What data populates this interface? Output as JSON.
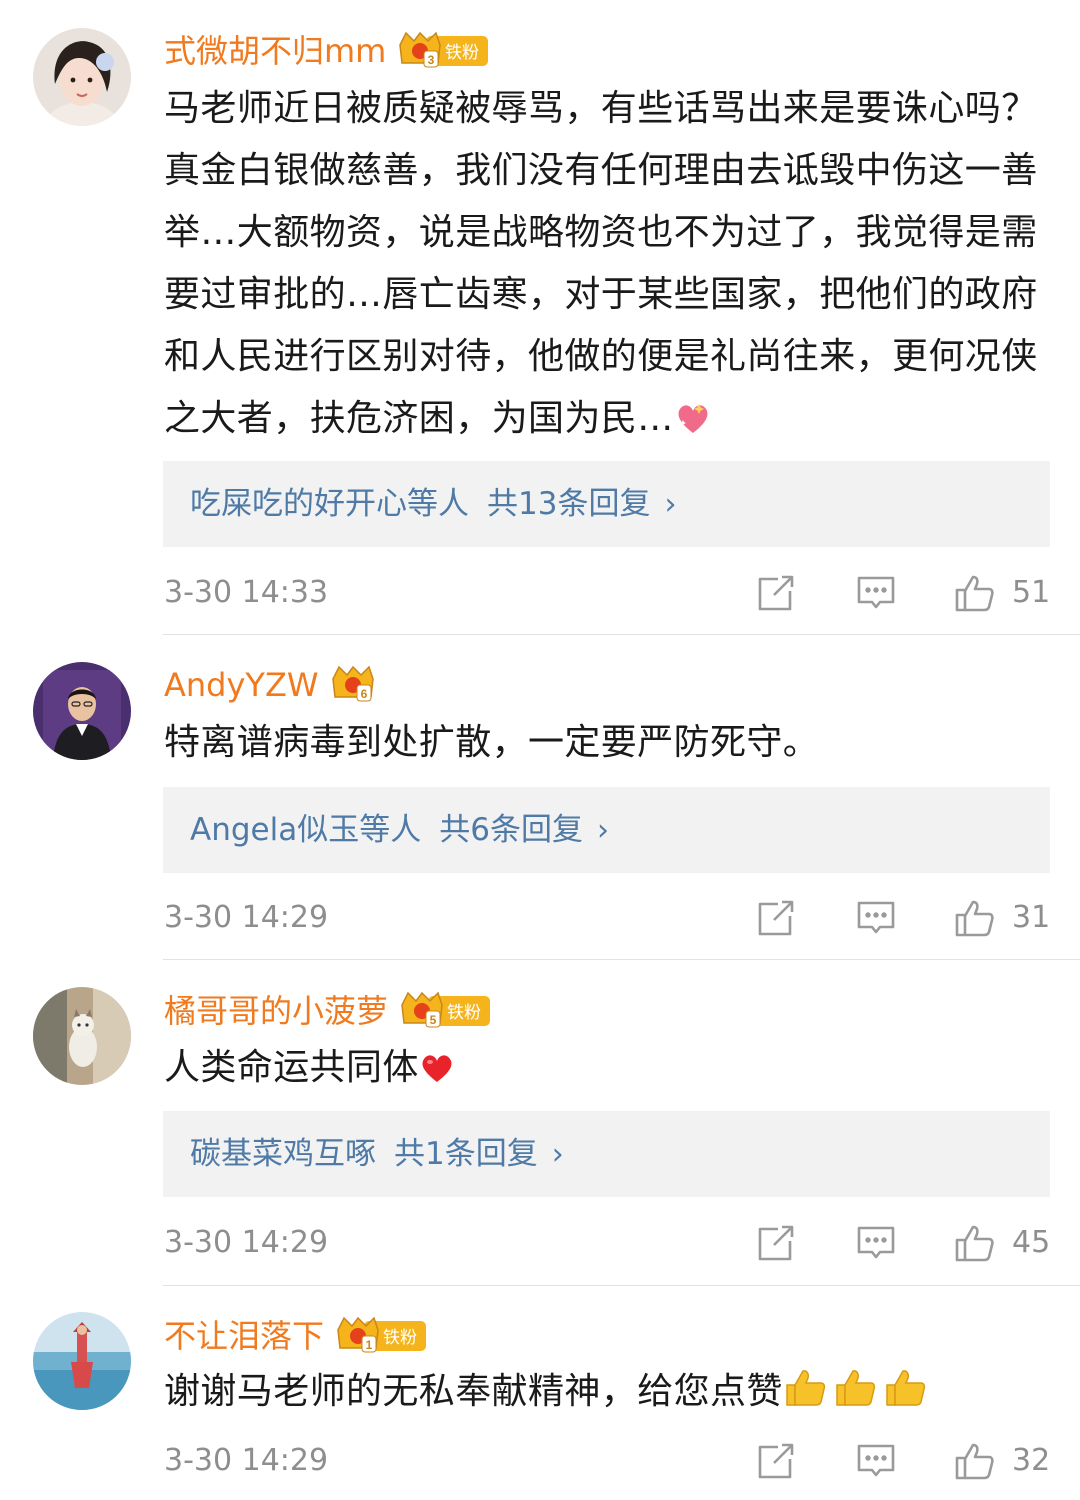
{
  "comments": [
    {
      "username": "式微胡不归mm",
      "badge_level": "3",
      "badge_label": "铁粉",
      "text": "马老师近日被质疑被辱骂，有些话骂出来是要诛心吗？真金白银做慈善，我们没有任何理由去诋毁中伤这一善举…大额物资，说是战略物资也不为过了，我觉得是需要过审批的…唇亡齿寒，对于某些国家，把他们的政府和人民进行区别对待，他做的便是礼尚往来，更何况侠之大者，扶危济困，为国为民…",
      "text_emoji": "sparkling-heart",
      "reply_names": "吃屎吃的好开心等人",
      "reply_count": "共13条回复",
      "timestamp": "3-30 14:33",
      "likes": "51"
    },
    {
      "username": "AndyYZW",
      "badge_level": "6",
      "badge_label": "",
      "text": "特离谱病毒到处扩散，一定要严防死守。",
      "text_emoji": "",
      "reply_names": "Angela似玉等人",
      "reply_count": "共6条回复",
      "timestamp": "3-30 14:29",
      "likes": "31"
    },
    {
      "username": "橘哥哥的小菠萝",
      "badge_level": "5",
      "badge_label": "铁粉",
      "text": "人类命运共同体",
      "text_emoji": "red-heart",
      "reply_names": "碳基菜鸡互啄",
      "reply_count": "共1条回复",
      "timestamp": "3-30 14:29",
      "likes": "45"
    },
    {
      "username": "不让泪落下",
      "badge_level": "1",
      "badge_label": "铁粉",
      "text": "谢谢马老师的无私奉献精神，给您点赞",
      "text_emoji": "thumbs-up x3",
      "reply_names": "",
      "reply_count": "",
      "timestamp": "3-30 14:29",
      "likes": "32"
    }
  ],
  "colors": {
    "username": "#f07a1d",
    "reply_link": "#4f7aa6",
    "meta_text": "#8e8e8e",
    "reply_box_bg": "#f2f2f2",
    "badge_gold": "#f5b41c"
  },
  "icons": {
    "repost": "repost-icon",
    "reply": "comment-icon",
    "like": "thumbs-up-icon"
  }
}
